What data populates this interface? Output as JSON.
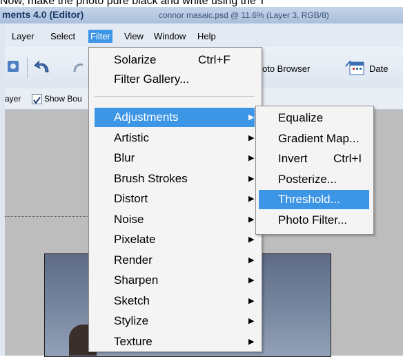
{
  "caption": "Now, make the photo pure black and white using the T",
  "window": {
    "app_title": "ments 4.0 (Editor)",
    "doc_title": "connor masaic.psd @ 11.6% (Layer 3, RGB/8)"
  },
  "menubar": {
    "items": [
      {
        "label": "Layer"
      },
      {
        "label": "Select"
      },
      {
        "label": "Filter"
      },
      {
        "label": "View"
      },
      {
        "label": "Window"
      },
      {
        "label": "Help"
      }
    ]
  },
  "toolbar": {
    "photo_browser_label": "oto Browser",
    "date_label": "Date"
  },
  "options": {
    "layer_label": "ayer",
    "show_bounding_label": "Show Bou"
  },
  "filter_menu": {
    "top_items": [
      {
        "label": "Solarize",
        "shortcut": "Ctrl+F"
      },
      {
        "label": "Filter Gallery..."
      }
    ],
    "submenu_items": [
      {
        "label": "Adjustments"
      },
      {
        "label": "Artistic"
      },
      {
        "label": "Blur"
      },
      {
        "label": "Brush Strokes"
      },
      {
        "label": "Distort"
      },
      {
        "label": "Noise"
      },
      {
        "label": "Pixelate"
      },
      {
        "label": "Render"
      },
      {
        "label": "Sharpen"
      },
      {
        "label": "Sketch"
      },
      {
        "label": "Stylize"
      },
      {
        "label": "Texture"
      }
    ],
    "arrow": "▶"
  },
  "adjustments_menu": {
    "items": [
      {
        "label": "Equalize"
      },
      {
        "label": "Gradient Map..."
      },
      {
        "label": "Invert",
        "shortcut": "Ctrl+I"
      },
      {
        "label": "Posterize..."
      },
      {
        "label": "Threshold..."
      },
      {
        "label": "Photo Filter..."
      }
    ]
  },
  "colors": {
    "highlight": "#3d95e6",
    "titlebar": "#b6c9e3",
    "menubar": "#e4eaf3"
  }
}
